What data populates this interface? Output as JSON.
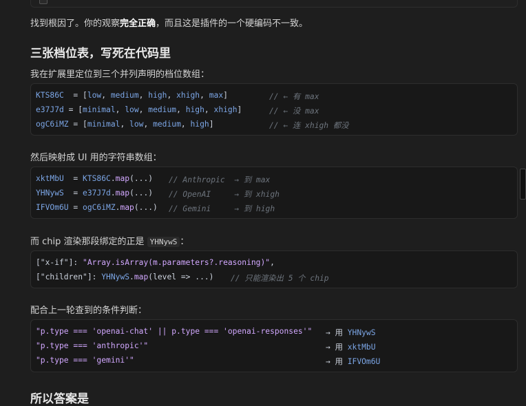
{
  "top_partial": "",
  "intro": {
    "part1": "找到根因了。你的观察",
    "bold": "完全正确",
    "part2": "，而且这是插件的一个硬编码不一致。"
  },
  "heading1": "三张档位表，写死在代码里",
  "para1": "我在扩展里定位到三个并列声明的档位数组：",
  "code1": [
    {
      "name": "KTS86C",
      "op": "  = [",
      "items": [
        "low",
        "medium",
        "high",
        "xhigh",
        "max"
      ],
      "close": "]",
      "comment": "// ← 有 max"
    },
    {
      "name": "e37J7d",
      "op": " = [",
      "items": [
        "minimal",
        "low",
        "medium",
        "high",
        "xhigh"
      ],
      "close": "]",
      "comment": "// ← 没 max"
    },
    {
      "name": "ogC6iMZ",
      "op": " = [",
      "items": [
        "minimal",
        "low",
        "medium",
        "high"
      ],
      "close": "]",
      "comment": "// ← 连 xhigh 都没"
    }
  ],
  "para2": "然后映射成 UI 用的字符串数组：",
  "code2": [
    {
      "name": "xktMbU",
      "op": "  = ",
      "src": "KTS86C",
      "fn": "map",
      "args": "(...)",
      "comment": "// Anthropic  → 到 max"
    },
    {
      "name": "YHNywS",
      "op": "  = ",
      "src": "e37J7d",
      "fn": "map",
      "args": "(...)",
      "comment": "// OpenAI     → 到 xhigh"
    },
    {
      "name": "IFVOm6U",
      "op": " = ",
      "src": "ogC6iMZ",
      "fn": "map",
      "args": "(...)",
      "comment": "// Gemini     → 到 high"
    }
  ],
  "para3": {
    "part1": "而 chip 渲染那段绑定的正是 ",
    "code": "YHNywS",
    "part2": "："
  },
  "code3": {
    "line1_key": "[\"x-if\"]",
    "line1_colon": ": ",
    "line1_val": "\"Array.isArray(m.parameters?.reasoning)\"",
    "line1_end": ",",
    "line2_key": "[\"children\"]",
    "line2_colon": ": ",
    "line2_var": "YHNywS",
    "line2_fn": "map",
    "line2_args": "(level => ...)",
    "line2_comment": "// 只能渲染出 5 个 chip"
  },
  "para4": "配合上一轮查到的条件判断：",
  "code4": [
    {
      "cond": "\"p.type === 'openai-chat' || p.type === 'openai-responses'\"",
      "arrow": "→ 用",
      "target": "YHNywS"
    },
    {
      "cond": "\"p.type === 'anthropic'\"",
      "arrow": "→ 用",
      "target": "xktMbU"
    },
    {
      "cond": "\"p.type === 'gemini'\"",
      "arrow": "→ 用",
      "target": "IFVOm6U"
    }
  ],
  "heading2": "所以答案是",
  "colors": {
    "background": "#1e1e1e",
    "code_bg": "#181818",
    "identifier": "#7ca6e6",
    "function": "#d2a8ff",
    "comment": "#6d747d"
  }
}
